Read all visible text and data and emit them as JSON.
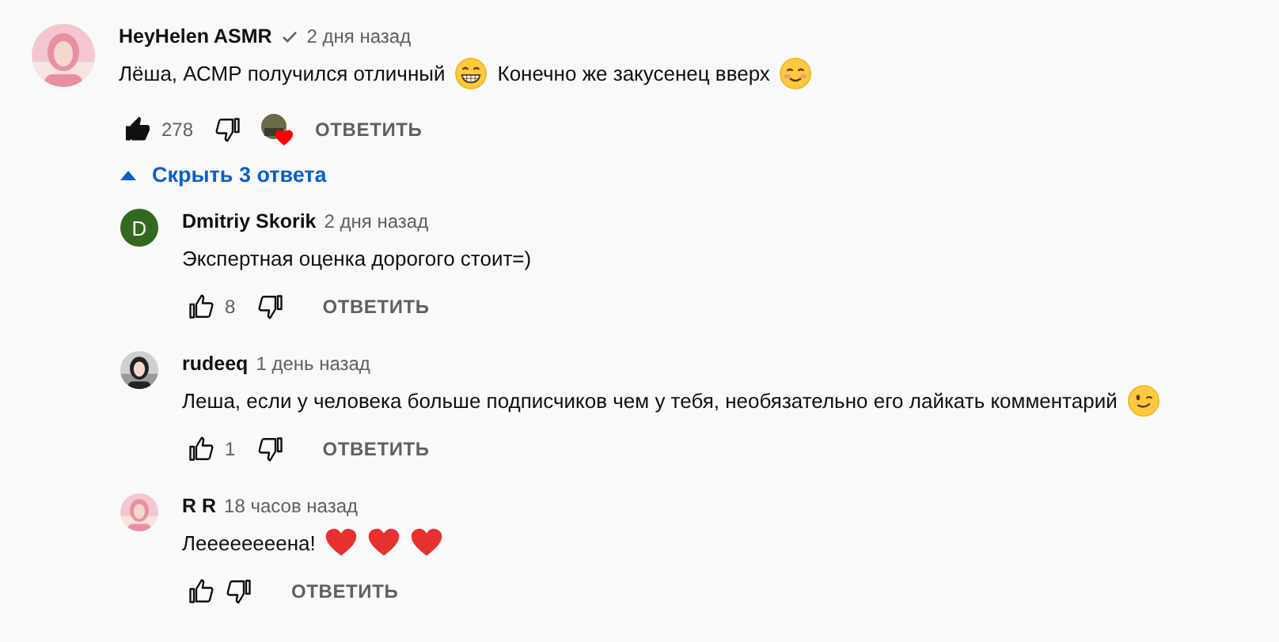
{
  "comment": {
    "avatar": {
      "kind": "picture"
    },
    "author": "HeyHelen ASMR",
    "verified": true,
    "time": "2 дня назад",
    "body": [
      {
        "kind": "text",
        "text": "Лёша, АСМР получился отличный"
      },
      {
        "kind": "grin"
      },
      {
        "kind": "text",
        "text": "Конечно же закусенец вверх"
      },
      {
        "kind": "smile"
      }
    ],
    "liked": true,
    "likes": "278",
    "hearted": true,
    "reply_label": "ОТВЕТИТЬ"
  },
  "toggle": {
    "label": "Скрыть 3 ответа",
    "expanded": true
  },
  "replies": [
    {
      "avatar": {
        "kind": "letter",
        "letter": "D"
      },
      "author": "Dmitriy Skorik",
      "verified": false,
      "time": "2 дня назад",
      "body": [
        {
          "kind": "text",
          "text": "Экспертная оценка дорогого стоит=)"
        }
      ],
      "liked": false,
      "likes": "8",
      "hearted": false,
      "reply_label": "ОТВЕТИТЬ"
    },
    {
      "avatar": {
        "kind": "picture"
      },
      "author": "rudeeq",
      "verified": false,
      "time": "1 день назад",
      "body": [
        {
          "kind": "text",
          "text": "Леша, если у человека больше подписчиков чем у тебя, необязательно его лайкать комментарий"
        },
        {
          "kind": "wink"
        }
      ],
      "liked": false,
      "likes": "1",
      "hearted": false,
      "reply_label": "ОТВЕТИТЬ"
    },
    {
      "avatar": {
        "kind": "picture"
      },
      "author": "R R",
      "verified": false,
      "time": "18 часов назад",
      "body": [
        {
          "kind": "text",
          "text": "Леееееееена!"
        },
        {
          "kind": "heart"
        },
        {
          "kind": "heart"
        },
        {
          "kind": "heart"
        }
      ],
      "liked": false,
      "hearted": false,
      "reply_label": "ОТВЕТИТЬ"
    }
  ]
}
